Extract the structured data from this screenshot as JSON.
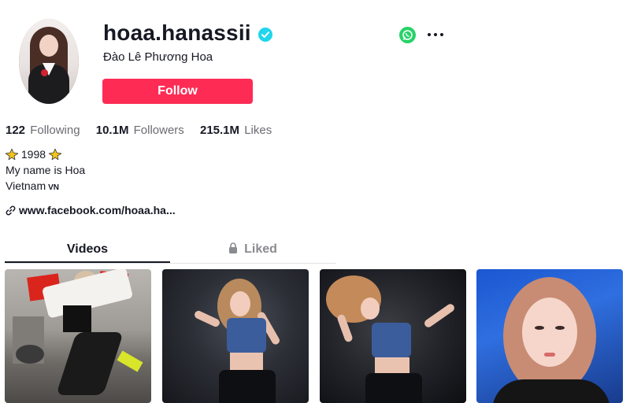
{
  "profile": {
    "username": "hoaa.hanassii",
    "display_name": "Đào Lê Phương Hoa",
    "follow_label": "Follow",
    "verified": true
  },
  "stats": [
    {
      "value": "122",
      "label": "Following"
    },
    {
      "value": "10.1M",
      "label": "Followers"
    },
    {
      "value": "215.1M",
      "label": "Likes"
    }
  ],
  "bio": {
    "line1": "1998",
    "line2": "My name is Hoa",
    "line3": "Vietnam",
    "country_code": "VN"
  },
  "link": {
    "text": "www.facebook.com/hoaa.ha..."
  },
  "tabs": [
    {
      "label": "Videos",
      "active": true
    },
    {
      "label": "Liked",
      "active": false,
      "icon": "lock-icon"
    }
  ],
  "icons": {
    "share": "whatsapp-icon",
    "more": "more-icon",
    "verified": "verified-badge-icon",
    "link": "link-icon"
  },
  "colors": {
    "follow_button": "#fe2c55",
    "verified": "#20d5ec",
    "whatsapp": "#25d366",
    "text_primary": "#161823",
    "text_secondary": "#6b6b73"
  },
  "videos": [
    {
      "id": "video-1"
    },
    {
      "id": "video-2"
    },
    {
      "id": "video-3"
    },
    {
      "id": "video-4"
    }
  ]
}
